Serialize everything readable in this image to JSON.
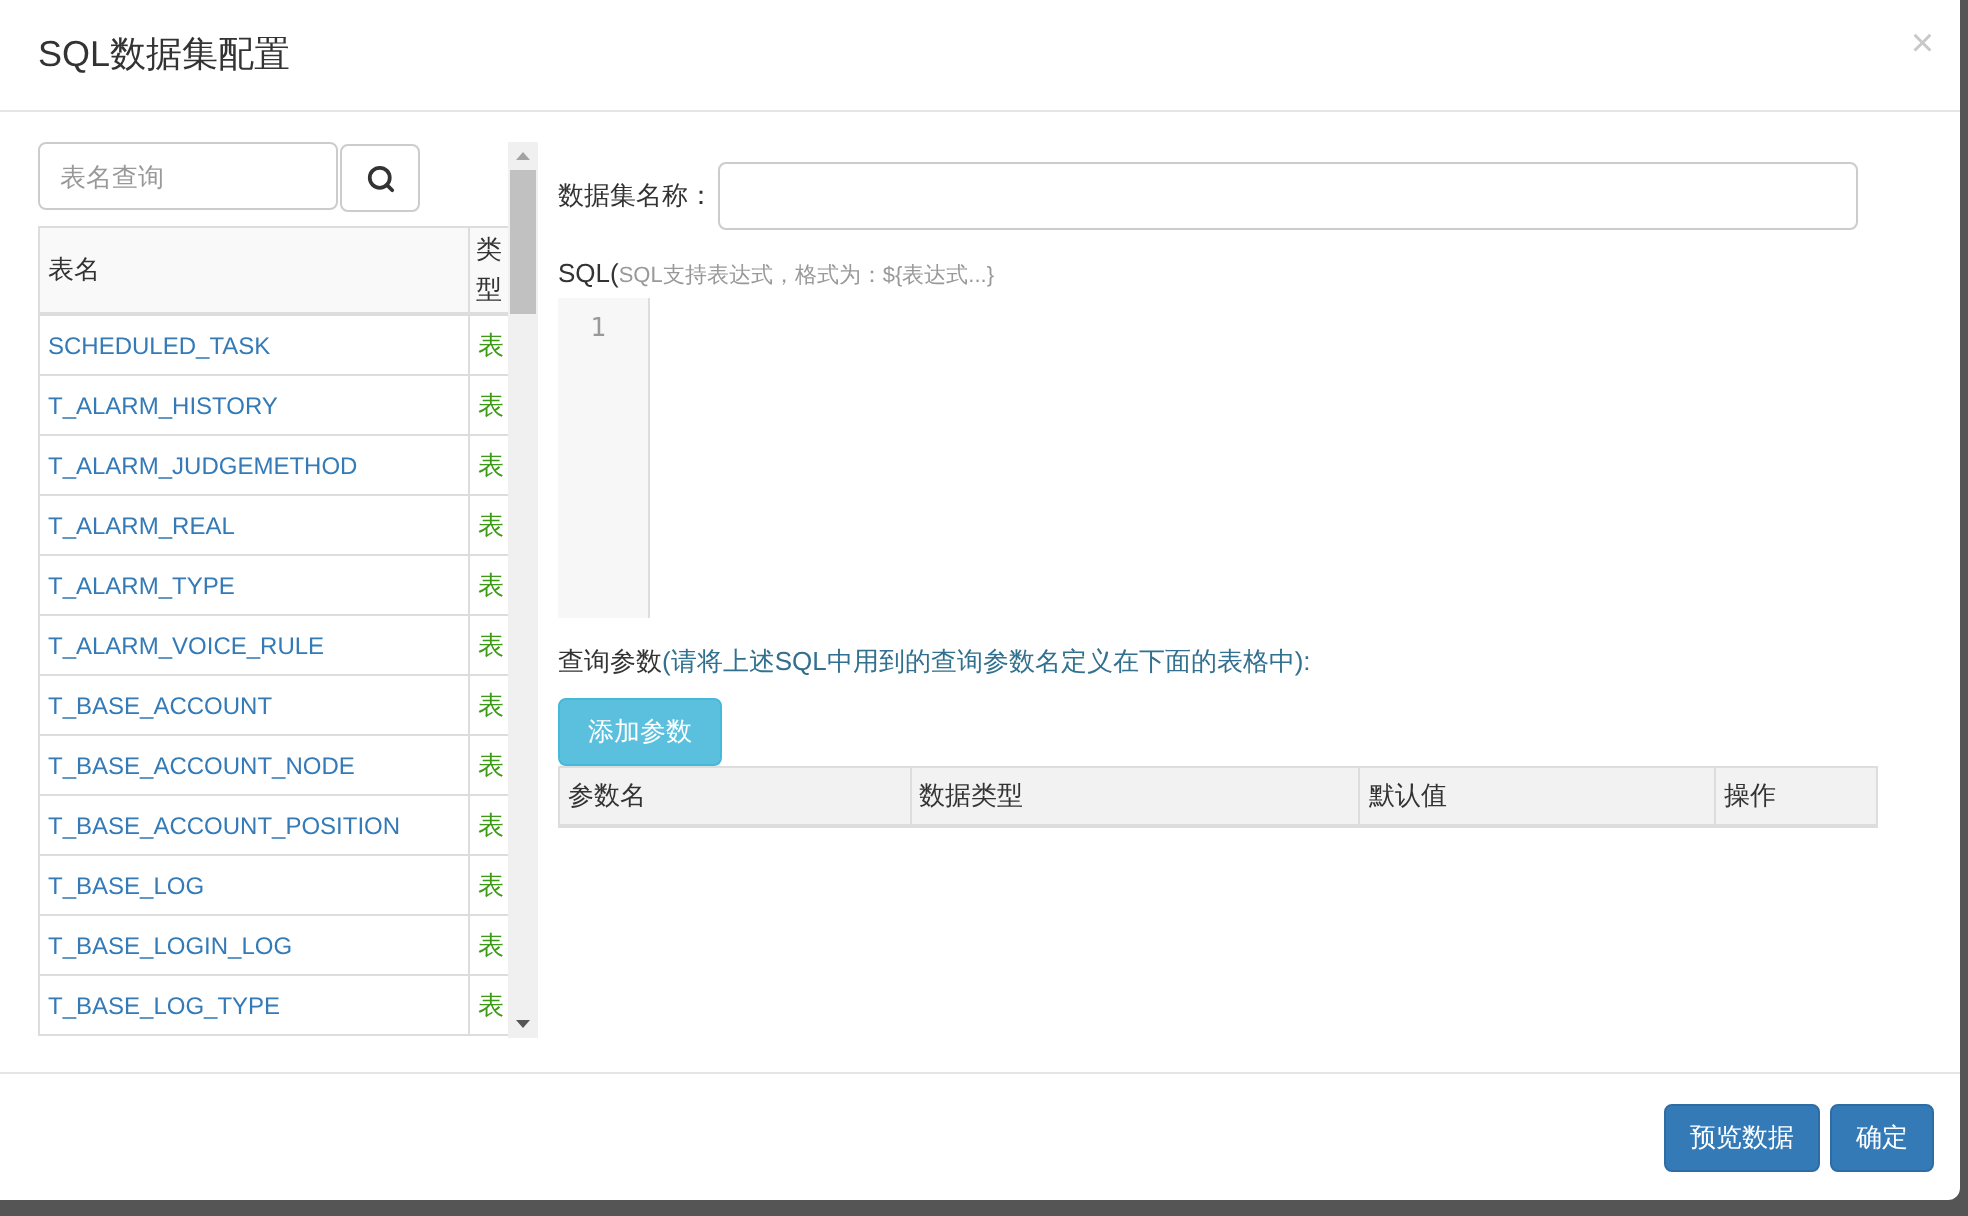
{
  "dialog": {
    "title": "SQL数据集配置",
    "close": "×"
  },
  "table_search": {
    "placeholder": "表名查询"
  },
  "table_list": {
    "columns": [
      "表名",
      "类型"
    ],
    "rows": [
      {
        "name": "SCHEDULED_TASK",
        "type": "表"
      },
      {
        "name": "T_ALARM_HISTORY",
        "type": "表"
      },
      {
        "name": "T_ALARM_JUDGEMETHOD",
        "type": "表"
      },
      {
        "name": "T_ALARM_REAL",
        "type": "表"
      },
      {
        "name": "T_ALARM_TYPE",
        "type": "表"
      },
      {
        "name": "T_ALARM_VOICE_RULE",
        "type": "表"
      },
      {
        "name": "T_BASE_ACCOUNT",
        "type": "表"
      },
      {
        "name": "T_BASE_ACCOUNT_NODE",
        "type": "表"
      },
      {
        "name": "T_BASE_ACCOUNT_POSITION",
        "type": "表"
      },
      {
        "name": "T_BASE_LOG",
        "type": "表"
      },
      {
        "name": "T_BASE_LOGIN_LOG",
        "type": "表"
      },
      {
        "name": "T_BASE_LOG_TYPE",
        "type": "表"
      }
    ]
  },
  "dataset_name": {
    "label": "数据集名称："
  },
  "sql": {
    "label": "SQL(",
    "hint": "SQL支持表达式，格式为：${表达式...}",
    "line_numbers": [
      "1"
    ]
  },
  "query_params": {
    "label": "查询参数",
    "hint": "(请将上述SQL中用到的查询参数名定义在下面的表格中):",
    "add_button": "添加参数",
    "columns": [
      "参数名",
      "数据类型",
      "默认值",
      "操作"
    ]
  },
  "footer_buttons": [
    "预览数据",
    "确定"
  ]
}
